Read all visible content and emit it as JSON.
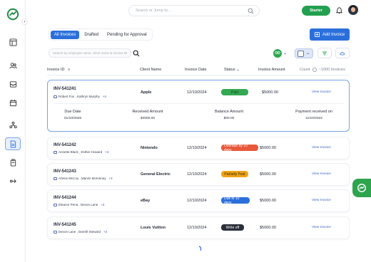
{
  "topbar": {
    "search_placeholder": "Search or Jump to...",
    "plan_button": "Starter"
  },
  "tabs": [
    {
      "label": "All Invoices",
      "active": true
    },
    {
      "label": "Drafted",
      "active": false
    },
    {
      "label": "Pending for Approval",
      "active": false
    }
  ],
  "actions": {
    "add_invoice": "Add Invoice",
    "filter_search_placeholder": "Search by employee name, client name & invoice ID",
    "user_initials": "OD"
  },
  "table": {
    "headers": {
      "invoice_id": "Invoice ID",
      "client_name": "Client Name",
      "invoice_date": "Invoice Date",
      "status": "Status",
      "invoice_amount": "Invoice Amount",
      "count": "Count",
      "count_value": "~1000 Invoices"
    },
    "rows": [
      {
        "id": "INV-541241",
        "assignees": "Robert Fox , Kathryn Murphy",
        "more": "+4",
        "client": "Apple",
        "date": "12/10/2024",
        "status": "Paid",
        "amount": "$5000.00",
        "action": "View Invoice",
        "details": {
          "due_date_label": "Due Date",
          "due_date": "01/10/2025",
          "received_label": "Received Amount",
          "received": "$4000.00",
          "balance_label": "Balance Amount",
          "balance": "$00.00",
          "payment_label": "Payment received on",
          "payment": "11/10/2023"
        }
      },
      {
        "id": "INV-541242",
        "assignees": "Annette Black , Esther Howard",
        "more": "+4",
        "client": "Nintendo",
        "date": "12/10/2024",
        "status": "Overdue by 10 days",
        "amount": "$5000.00",
        "action": "View Invoice"
      },
      {
        "id": "INV-541243",
        "assignees": "Arlene McCoy , Marvin McKinney",
        "more": "+2",
        "client": "General Electric",
        "date": "12/10/2024",
        "status": "Partially Paid",
        "amount": "$5000.00",
        "action": "View Invoice"
      },
      {
        "id": "INV-541244",
        "assignees": "Eleanor Pena , Devon Lane",
        "more": "+2",
        "client": "eBay",
        "date": "12/10/2024",
        "status": "Due in 10 days",
        "amount": "$5000.00",
        "action": "View Invoice"
      },
      {
        "id": "INV-541245",
        "assignees": "Devon Lane , Darrell Steward",
        "more": "+2",
        "client": "Louis Vuitton",
        "date": "12/10/2024",
        "status": "Write off",
        "amount": "$5000.00",
        "action": "View Invoice"
      }
    ]
  },
  "colors": {
    "accent": "#2b6fdb",
    "brand_green": "#23a04f",
    "paid": "#34a853",
    "overdue": "#e8593b",
    "partial": "#f0a418",
    "due": "#2b6fdb",
    "writeoff": "#2b2f3a"
  }
}
